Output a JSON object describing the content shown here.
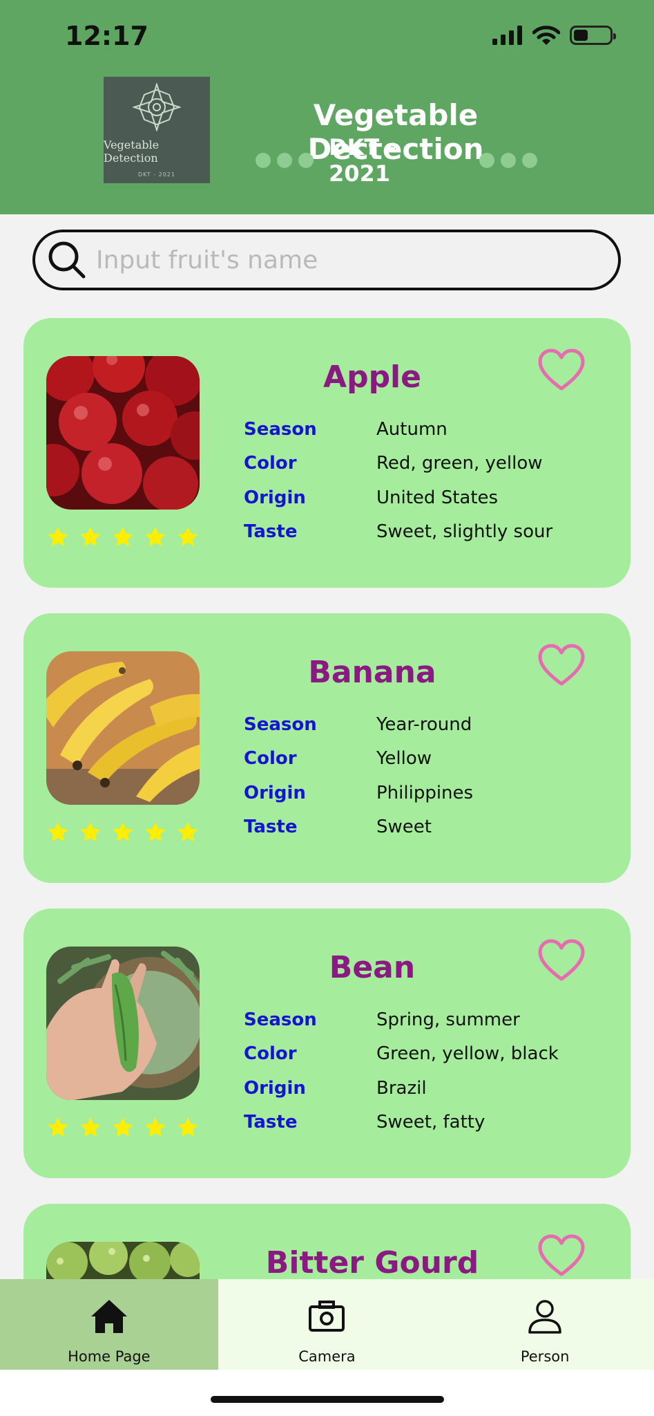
{
  "status_bar": {
    "time": "12:17"
  },
  "header": {
    "logo_text": "Vegetable Detection",
    "logo_subtext": "DKT - 2021",
    "title": "Vegetable Dectection",
    "subtitle": "DKT - 2021"
  },
  "search": {
    "placeholder": "Input fruit's name",
    "value": ""
  },
  "field_labels": {
    "season": "Season",
    "color": "Color",
    "origin": "Origin",
    "taste": "Taste"
  },
  "items": [
    {
      "name": "Apple",
      "season": "Autumn",
      "color": "Red, green, yellow",
      "origin": "United States",
      "taste": "Sweet, slightly sour",
      "rating": 5,
      "favorite": false
    },
    {
      "name": "Banana",
      "season": "Year-round",
      "color": "Yellow",
      "origin": "Philippines",
      "taste": "Sweet",
      "rating": 5,
      "favorite": false
    },
    {
      "name": "Bean",
      "season": "Spring, summer",
      "color": "Green, yellow, black",
      "origin": "Brazil",
      "taste": "Sweet, fatty",
      "rating": 5,
      "favorite": false
    },
    {
      "name": "Bitter Gourd",
      "favorite": false
    }
  ],
  "bottom_nav": [
    {
      "label": "Home Page",
      "icon": "home-icon",
      "active": true
    },
    {
      "label": "Camera",
      "icon": "camera-icon",
      "active": false
    },
    {
      "label": "Person",
      "icon": "person-icon",
      "active": false
    }
  ],
  "colors": {
    "header_bg": "#5ea662",
    "card_bg": "#a5ed9c",
    "name_color": "#8a1a82",
    "label_color": "#1515d0",
    "heart_color": "#e86ab0",
    "star_color": "#ffee00",
    "nav_active_bg": "#a9d193",
    "nav_bg": "#f0fbe8"
  }
}
